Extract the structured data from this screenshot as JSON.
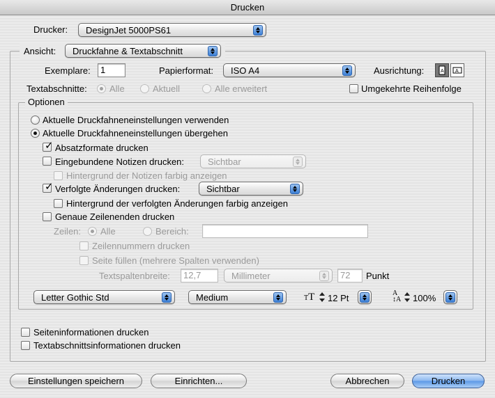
{
  "window": {
    "title": "Drucken"
  },
  "printer": {
    "label": "Drucker:",
    "value": "DesignJet 5000PS61"
  },
  "view": {
    "label": "Ansicht:",
    "value": "Druckfahne & Textabschnitt"
  },
  "copies": {
    "label": "Exemplare:",
    "value": "1"
  },
  "paper": {
    "label": "Papierformat:",
    "value": "ISO A4"
  },
  "orientation": {
    "label": "Ausrichtung:",
    "portrait_icon": "portrait-icon",
    "landscape_icon": "landscape-icon"
  },
  "stories": {
    "label": "Textabschnitte:",
    "all": "Alle",
    "current": "Aktuell",
    "all_extended": "Alle erweitert"
  },
  "reverse_order": {
    "label": "Umgekehrte Reihenfolge"
  },
  "options": {
    "title": "Optionen",
    "use_settings": "Aktuelle Druckfahneneinstellungen verwenden",
    "override_settings": "Aktuelle Druckfahneneinstellungen übergehen",
    "paragraph_styles": "Absatzformate drucken",
    "inline_notes": "Eingebundene Notizen drucken:",
    "inline_notes_value": "Sichtbar",
    "notes_background": "Hintergrund der Notizen farbig anzeigen",
    "tracked_changes": "Verfolgte Änderungen drucken:",
    "tracked_changes_value": "Sichtbar",
    "changes_background": "Hintergrund der verfolgten Änderungen farbig anzeigen",
    "accurate_line_endings": "Genaue Zeilenenden drucken",
    "lines_label": "Zeilen:",
    "lines_all": "Alle",
    "lines_range": "Bereich:",
    "line_numbers": "Zeilennummern drucken",
    "fill_page": "Seite füllen (mehrere Spalten verwenden)",
    "column_width_label": "Textspaltenbreite:",
    "column_width_value": "12,7",
    "unit": "Millimeter",
    "points_value": "72",
    "points_label": "Punkt",
    "font": "Letter Gothic Std",
    "font_style": "Medium",
    "font_size": "12 Pt",
    "line_spacing": "100%"
  },
  "page_info": {
    "label": "Seiteninformationen drucken"
  },
  "story_info": {
    "label": "Textabschnittsinformationen drucken"
  },
  "buttons": {
    "save_settings": "Einstellungen speichern",
    "setup": "Einrichten...",
    "cancel": "Abbrechen",
    "print": "Drucken"
  },
  "colors": {
    "default_button": "#5b98e6",
    "popup_arrow": "#3d80d6"
  }
}
